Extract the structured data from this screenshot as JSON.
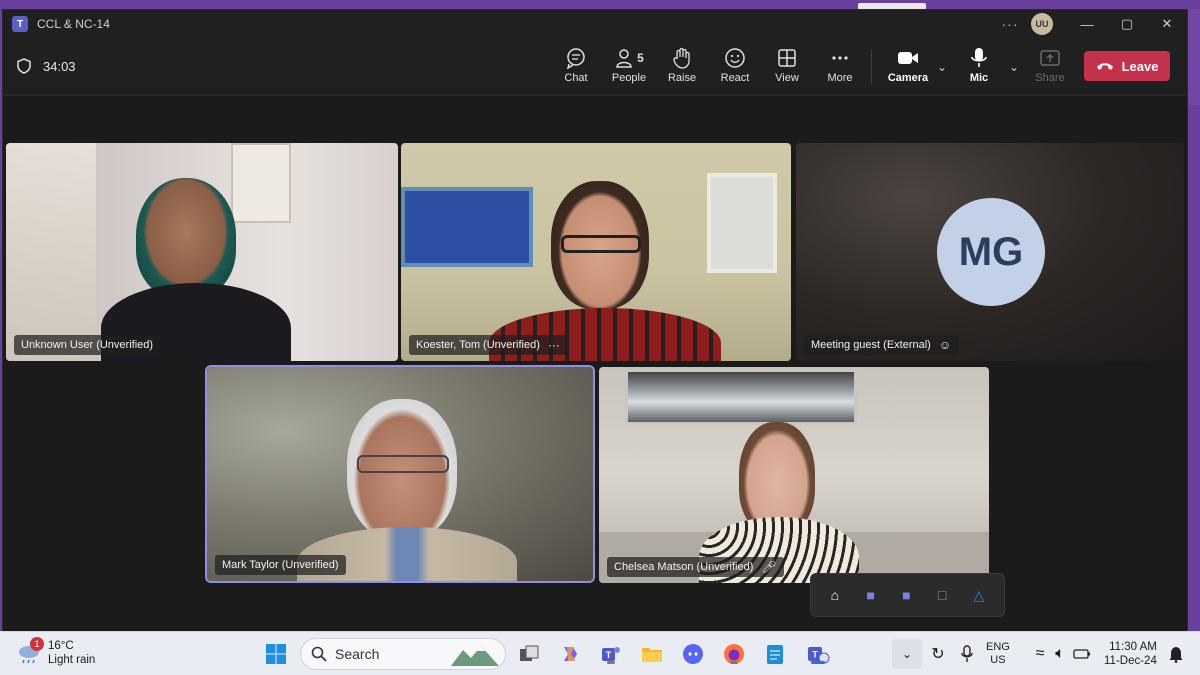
{
  "window": {
    "title": "CCL & NC-14",
    "user_initials": "UU"
  },
  "toolbar": {
    "timer": "34:03",
    "buttons": [
      {
        "label": "Chat",
        "icon": "chat-icon"
      },
      {
        "label": "People",
        "icon": "people-icon",
        "count": "5"
      },
      {
        "label": "Raise",
        "icon": "raise-hand-icon"
      },
      {
        "label": "React",
        "icon": "react-icon"
      },
      {
        "label": "View",
        "icon": "view-icon"
      },
      {
        "label": "More",
        "icon": "more-icon"
      }
    ],
    "camera_label": "Camera",
    "mic_label": "Mic",
    "share_label": "Share",
    "leave_label": "Leave",
    "leave_color": "#c4314b"
  },
  "participants": [
    {
      "name": "Unknown User (Unverified)"
    },
    {
      "name": "Koester, Tom (Unverified)",
      "extra": "···"
    },
    {
      "name": "Meeting guest (External)",
      "initials": "MG"
    },
    {
      "name": "Mark Taylor (Unverified)",
      "active_speaker": true
    },
    {
      "name": "Chelsea Matson (Unverified)",
      "muted": true
    }
  ],
  "taskbar": {
    "weather_temp": "16°C",
    "weather_desc": "Light rain",
    "weather_badge": "1",
    "search_label": "Search",
    "lang_top": "ENG",
    "lang_bottom": "US",
    "time": "11:30 AM",
    "date": "11-Dec-24"
  }
}
